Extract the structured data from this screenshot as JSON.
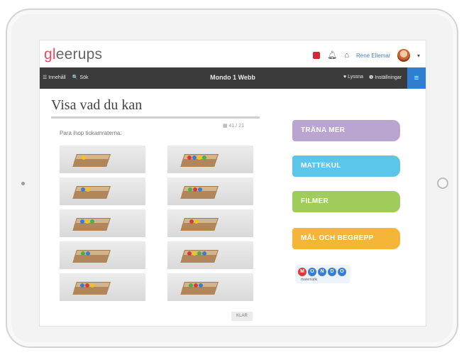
{
  "app": {
    "logo": "gleerups",
    "user": "Rene Ellemann"
  },
  "navbar": {
    "left_items": [
      "☰ Innehåll",
      "🔍 Sök"
    ],
    "title": "Mondo 1 Webb",
    "right_items": [
      "♥ Lyssna",
      "❶ Inställningar"
    ]
  },
  "content": {
    "title": "Visa vad du kan",
    "page_meta": "▦ 41 / 21",
    "instruction": "Para ihop tiokamraterna.",
    "next_label": "KLAR"
  },
  "side_buttons": [
    {
      "label": "TRÄNA MER",
      "color": "#b9a5cf"
    },
    {
      "label": "MATTEKUL",
      "color": "#5bc6ea"
    },
    {
      "label": "FILMER",
      "color": "#9fcc5b"
    },
    {
      "label": "MÅL OCH BEGREPP",
      "color": "#f5b538"
    }
  ],
  "mondo_badge": {
    "letters": [
      "M",
      "O",
      "N",
      "D",
      "O"
    ],
    "subtitle": "matematik"
  },
  "colors": {
    "navbar": "#3b3b3b",
    "menu_accent": "#2f7fd0"
  }
}
